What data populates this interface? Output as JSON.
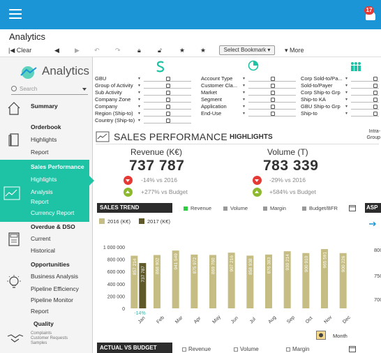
{
  "app": {
    "page_title": "Analytics",
    "notification_count": "17"
  },
  "toolbar": {
    "clear_label": "Clear",
    "bookmark_label": "Select Bookmark",
    "more_label": "More"
  },
  "sidebar": {
    "logo_text": "Analytics",
    "search_placeholder": "Search",
    "sections": [
      {
        "title": "Summary",
        "items": []
      },
      {
        "title": "Orderbook",
        "items": [
          "Highlights",
          "Report"
        ]
      },
      {
        "title": "Sales Performance",
        "items": [
          "Highlights",
          "Analysis",
          "Report",
          "Currency Report"
        ]
      },
      {
        "title": "Overdue & DSO",
        "items": [
          "Current",
          "Historical"
        ]
      },
      {
        "title": "Opportunities",
        "items": [
          "Business Analysis",
          "Pipeline Efficiency",
          "Pipeline Monitor",
          "Report"
        ]
      },
      {
        "title": "Quality",
        "items": [
          "Complaints",
          "Customer Requests",
          "Samples"
        ]
      }
    ]
  },
  "filters": {
    "col1": [
      "GBU",
      "Group of Activity",
      "Sub Activity",
      "Company Zone",
      "Company",
      "Region (Ship-to)",
      "Country (Ship-to)"
    ],
    "col2": [
      "Account Type",
      "Customer Cla...",
      "Market",
      "Segment",
      "Application",
      "End-Use"
    ],
    "col3": [
      "Corp Sold-to/Pa...",
      "Sold-to/Payer",
      "Corp Ship-to Grp",
      "Ship-to KA",
      "GBU Ship-to Grp",
      "Ship-to"
    ]
  },
  "main": {
    "section_title": "SALES PERFORMANCE",
    "highlights_tab": "HIGHLIGHTS",
    "intra_label": "Intra-\nGroup",
    "revenue": {
      "title": "Revenue (K€)",
      "value": "737 787",
      "vs_prev": "-14% vs 2016",
      "vs_budget": "+277% vs Budget"
    },
    "volume": {
      "title": "Volume (T)",
      "value": "783 339",
      "vs_prev": "-29% vs 2016",
      "vs_budget": "+584% vs Budget"
    },
    "sales_trend_title": "SALES TREND",
    "trend_legend": [
      "Revenue",
      "Volume",
      "Margin",
      "Budget/BFR"
    ],
    "asp_title": "ASP",
    "avb_title": "ACTUAL VS BUDGET",
    "avb_legend": [
      "Revenue",
      "Volume",
      "Margin"
    ],
    "month_label": "Month",
    "right_axis_values": [
      "800",
      "750",
      "700"
    ]
  },
  "colors": {
    "accent_blue": "#1b95d6",
    "teal": "#1ec3a5",
    "bar_2016": "#c5bd83",
    "bar_2017": "#5f5929",
    "negative_pct": "#2fb6a6"
  },
  "chart_data": {
    "type": "bar",
    "categories": [
      "Jan",
      "Feb",
      "Mar",
      "Apr",
      "May",
      "Jun",
      "Jul",
      "Aug",
      "Sep",
      "Oct",
      "Nov",
      "Dec"
    ],
    "series": [
      {
        "name": "2016 (K€)",
        "values": [
          857214,
          868902,
          941549,
          875972,
          869760,
          907216,
          858938,
          876383,
          930214,
          900910,
          965591,
          900226
        ]
      },
      {
        "name": "2017 (K€)",
        "values": [
          737787,
          null,
          null,
          null,
          null,
          null,
          null,
          null,
          null,
          null,
          null,
          null
        ]
      }
    ],
    "data_labels": [
      [
        "857 214",
        "868 902",
        "941 549",
        "875 972",
        "869 760",
        "907 216",
        "858 938",
        "876 383",
        "930 214",
        "900 910",
        "965 591",
        "900 226"
      ],
      [
        "737 787"
      ]
    ],
    "change_label": "-14%",
    "ylim": [
      0,
      1000000
    ],
    "yticks": [
      "0",
      "200 000",
      "400 000",
      "600 000",
      "800 000",
      "1 000 000"
    ],
    "grid": false,
    "legend": "top-left"
  }
}
